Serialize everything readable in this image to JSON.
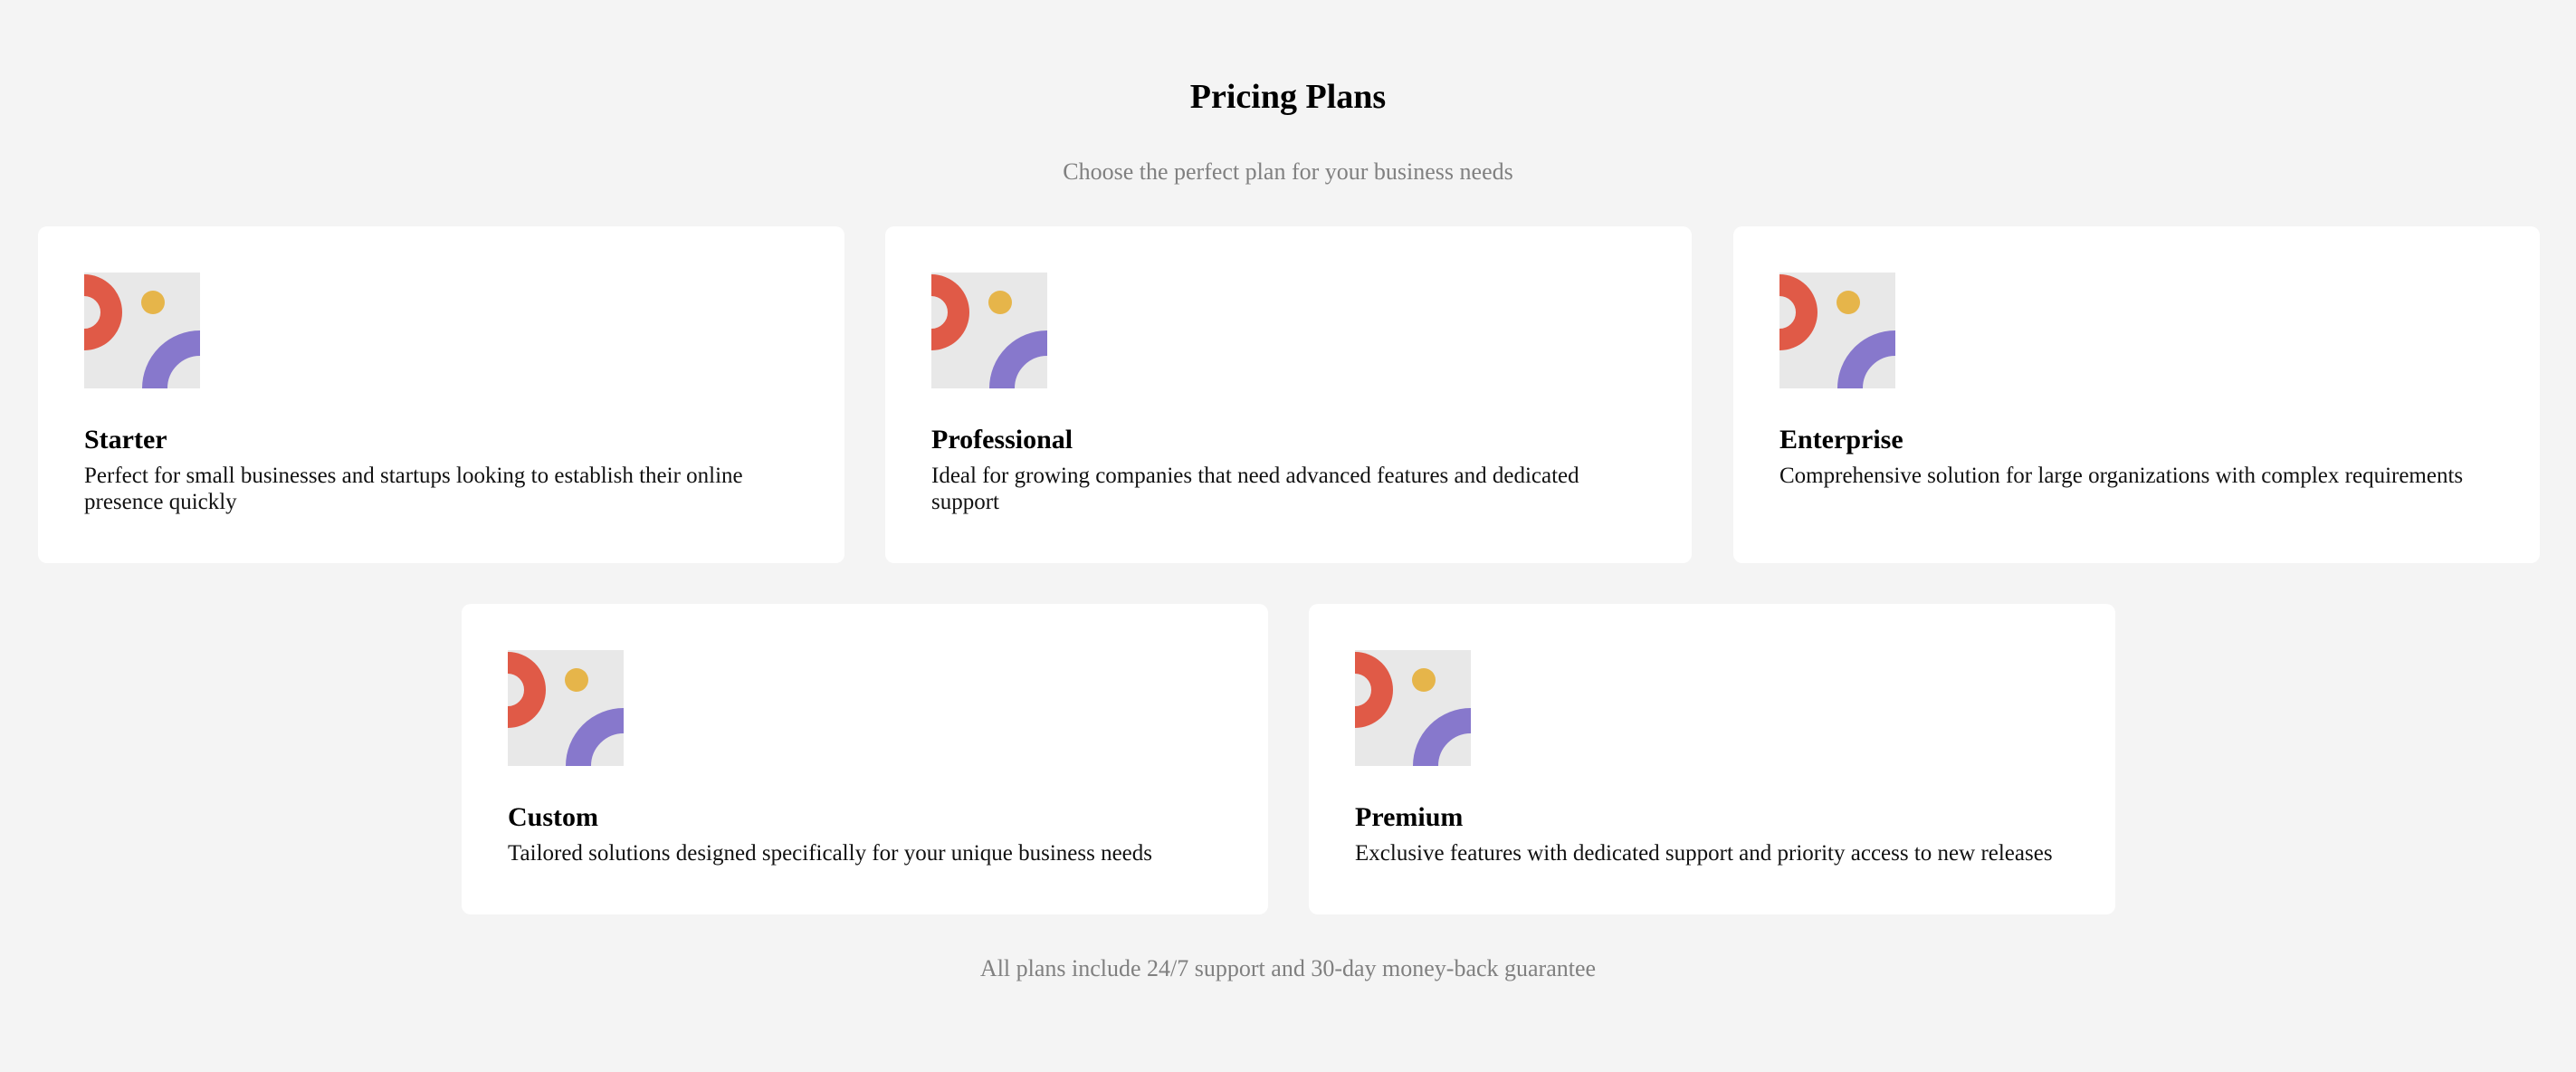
{
  "header": {
    "title": "Pricing Plans",
    "subtitle": "Choose the perfect plan for your business needs"
  },
  "plans": [
    {
      "name": "Starter",
      "description": "Perfect for small businesses and startups looking to establish their online presence quickly",
      "icon": "abstract-shapes-image"
    },
    {
      "name": "Professional",
      "description": "Ideal for growing companies that need advanced features and dedicated support",
      "icon": "abstract-shapes-image"
    },
    {
      "name": "Enterprise",
      "description": "Comprehensive solution for large organizations with complex requirements",
      "icon": "abstract-shapes-image"
    },
    {
      "name": "Custom",
      "description": "Tailored solutions designed specifically for your unique business needs",
      "icon": "abstract-shapes-image"
    },
    {
      "name": "Premium",
      "description": "Exclusive features with dedicated support and priority access to new releases",
      "icon": "abstract-shapes-image"
    }
  ],
  "footer": {
    "note": "All plans include 24/7 support and 30-day money-back guarantee"
  },
  "colors": {
    "background": "#f4f4f4",
    "card": "#ffffff",
    "muted_text": "#808080",
    "image_bg": "#e8e8e8",
    "accent_red": "#e05a47",
    "accent_yellow": "#e6b54a",
    "accent_purple": "#7c6bc9"
  }
}
